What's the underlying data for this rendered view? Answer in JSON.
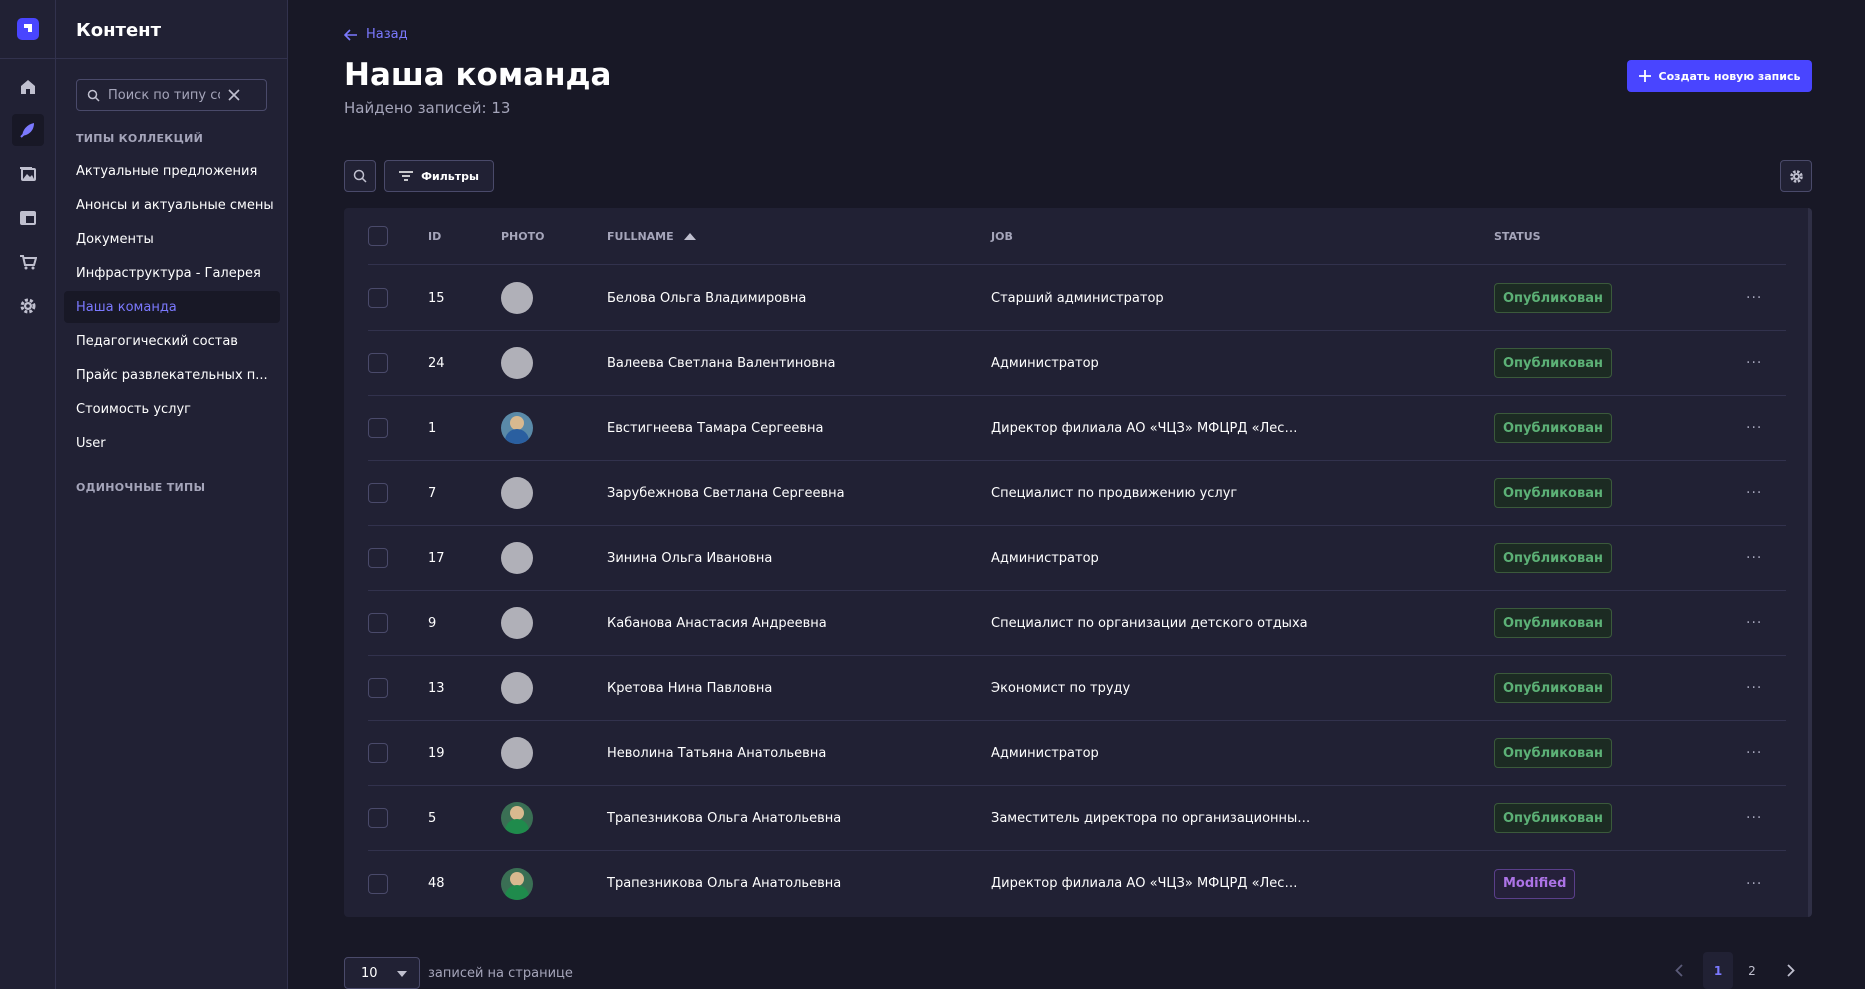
{
  "rail": {
    "items": [
      {
        "name": "home-icon"
      },
      {
        "name": "content-manager-icon",
        "active": true
      },
      {
        "name": "media-library-icon"
      },
      {
        "name": "content-type-builder-icon"
      },
      {
        "name": "marketplace-icon"
      },
      {
        "name": "settings-icon"
      }
    ]
  },
  "sidebar": {
    "title": "Контент",
    "search_placeholder": "Поиск по типу содержимого",
    "collection_label": "ТИПЫ КОЛЛЕКЦИЙ",
    "single_label": "ОДИНОЧНЫЕ ТИПЫ",
    "items": [
      {
        "label": "Актуальные предложения"
      },
      {
        "label": "Анонсы и актуальные смены"
      },
      {
        "label": "Документы"
      },
      {
        "label": "Инфраструктура - Галерея"
      },
      {
        "label": "Наша команда",
        "active": true
      },
      {
        "label": "Педагогический состав"
      },
      {
        "label": "Прайс развлекательных п..."
      },
      {
        "label": "Стоимость услуг"
      },
      {
        "label": "User"
      }
    ]
  },
  "header": {
    "back_label": "Назад",
    "title": "Наша команда",
    "subtitle": "Найдено записей: 13",
    "create_label": "Создать новую запись"
  },
  "toolbar": {
    "filters_label": "Фильтры"
  },
  "table": {
    "columns": {
      "id": "ID",
      "photo": "PHOTO",
      "fullname": "FULLNAME",
      "job": "JOB",
      "status": "STATUS"
    },
    "rows": [
      {
        "id": "15",
        "photo": "placeholder",
        "fullname": "Белова Ольга Владимировна",
        "job": "Старший администратор",
        "status": "Опубликован",
        "status_type": "published"
      },
      {
        "id": "24",
        "photo": "placeholder",
        "fullname": "Валеева Светлана Валентиновна",
        "job": "Администратор",
        "status": "Опубликован",
        "status_type": "published"
      },
      {
        "id": "1",
        "photo": "photo-blue",
        "fullname": "Евстигнеева Тамара Сергеевна",
        "job": "Директор филиала АО «ЧЦЗ» МФЦРД «Лес…",
        "status": "Опубликован",
        "status_type": "published"
      },
      {
        "id": "7",
        "photo": "placeholder",
        "fullname": "Зарубежнова Светлана Сергеевна",
        "job": "Специалист по продвижению услуг",
        "status": "Опубликован",
        "status_type": "published"
      },
      {
        "id": "17",
        "photo": "placeholder",
        "fullname": "Зинина Ольга Ивановна",
        "job": "Администратор",
        "status": "Опубликован",
        "status_type": "published"
      },
      {
        "id": "9",
        "photo": "placeholder",
        "fullname": "Кабанова Анастасия Андреевна",
        "job": "Специалист по организации детского отдыха",
        "status": "Опубликован",
        "status_type": "published"
      },
      {
        "id": "13",
        "photo": "placeholder",
        "fullname": "Кретова Нина Павловна",
        "job": "Экономист по труду",
        "status": "Опубликован",
        "status_type": "published"
      },
      {
        "id": "19",
        "photo": "placeholder",
        "fullname": "Неволина Татьяна Анатольевна",
        "job": "Администратор",
        "status": "Опубликован",
        "status_type": "published"
      },
      {
        "id": "5",
        "photo": "photo-green",
        "fullname": "Трапезникова Ольга Анатольевна",
        "job": "Заместитель директора по организационны…",
        "status": "Опубликован",
        "status_type": "published"
      },
      {
        "id": "48",
        "photo": "photo-green",
        "fullname": "Трапезникова Ольга Анатольевна",
        "job": "Директор филиала АО «ЧЦЗ» МФЦРД «Лес…",
        "status": "Modified",
        "status_type": "modified"
      }
    ],
    "row_actions_label": "···"
  },
  "pagination": {
    "page_size": "10",
    "page_size_label": "записей на странице",
    "pages": [
      "1",
      "2"
    ],
    "current_page": "1"
  },
  "colors": {
    "accent": "#4945ff",
    "accent_text": "#7b79ff",
    "published": "#5cb176",
    "modified": "#ac73e6",
    "background": "#181826",
    "surface": "#212134"
  }
}
